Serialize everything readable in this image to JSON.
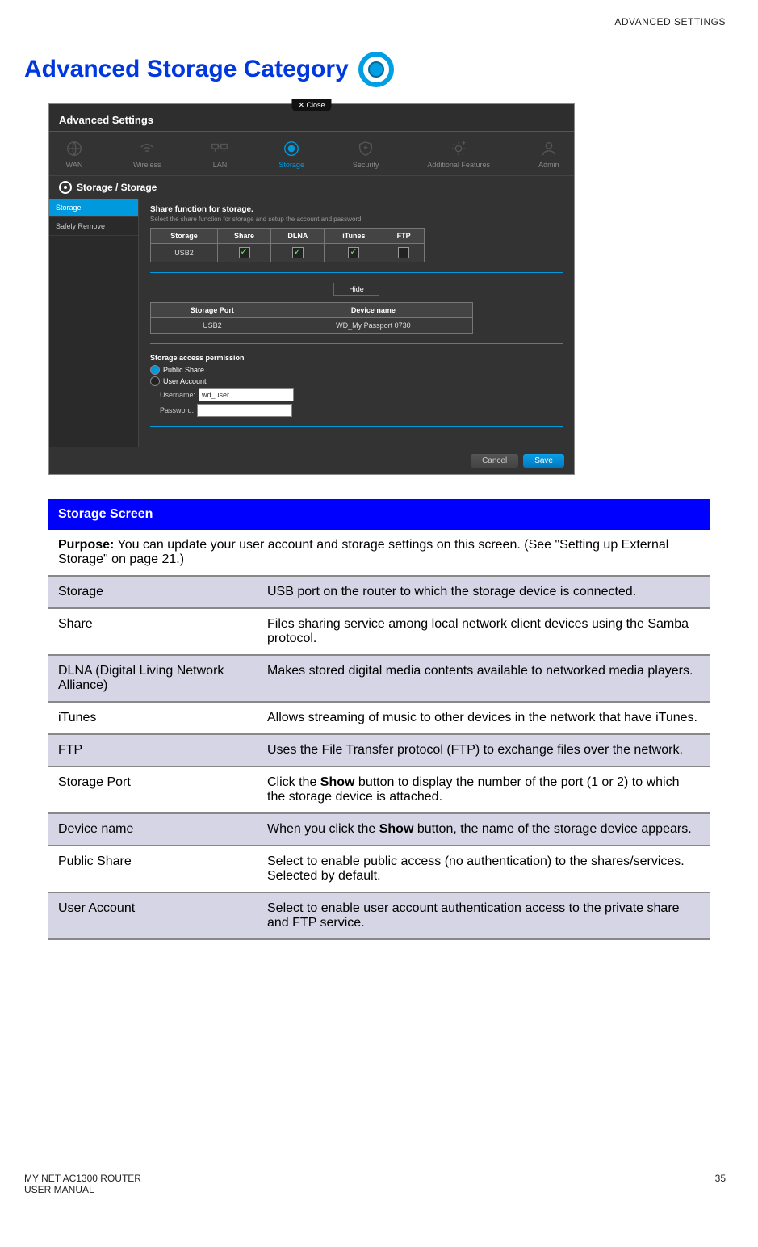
{
  "header": {
    "section": "ADVANCED SETTINGS"
  },
  "title": "Advanced Storage Category",
  "screenshot": {
    "close": "✕ Close",
    "window_title": "Advanced Settings",
    "nav": [
      {
        "label": "WAN",
        "active": false
      },
      {
        "label": "Wireless",
        "active": false
      },
      {
        "label": "LAN",
        "active": false
      },
      {
        "label": "Storage",
        "active": true
      },
      {
        "label": "Security",
        "active": false
      },
      {
        "label": "Additional Features",
        "active": false
      },
      {
        "label": "Admin",
        "active": false
      }
    ],
    "breadcrumb": "Storage / Storage",
    "sidebar": [
      {
        "label": "Storage",
        "active": true
      },
      {
        "label": "Safely Remove",
        "active": false
      }
    ],
    "section_title": "Share function for storage.",
    "section_sub": "Select the share function for storage and setup the account and password.",
    "table1": {
      "headers": [
        "Storage",
        "Share",
        "DLNA",
        "iTunes",
        "FTP"
      ],
      "row": {
        "storage": "USB2",
        "share": true,
        "dlna": true,
        "itunes": true,
        "ftp": false
      }
    },
    "hide_btn": "Hide",
    "table2": {
      "headers": [
        "Storage Port",
        "Device name"
      ],
      "row": [
        "USB2",
        "WD_My Passport 0730"
      ]
    },
    "permission_title": "Storage access permission",
    "radio_public": "Public Share",
    "radio_user": "User Account",
    "username_label": "Username:",
    "username_value": "wd_user",
    "password_label": "Password:",
    "password_value": "",
    "cancel": "Cancel",
    "save": "Save"
  },
  "desc": {
    "header": "Storage Screen",
    "purpose_label": "Purpose:",
    "purpose_text": " You can update your user account and storage settings on this screen. (See \"Setting up External Storage\" on page 21.)",
    "rows": [
      {
        "k": "Storage",
        "v": "USB port on the router to which the storage device is connected.",
        "shaded": true
      },
      {
        "k": "Share",
        "v": "Files sharing service among local network client devices using the Samba protocol.",
        "shaded": false
      },
      {
        "k": "DLNA (Digital Living Network Alliance)",
        "v": "Makes stored digital media contents available to networked media players.",
        "shaded": true
      },
      {
        "k": "iTunes",
        "v": "Allows streaming of music to other devices in the network that have iTunes.",
        "shaded": false
      },
      {
        "k": "FTP",
        "v": "Uses the File Transfer protocol (FTP) to exchange files over the network.",
        "shaded": true
      },
      {
        "k": "Storage Port",
        "v_pre": "Click the ",
        "v_b": "Show",
        "v_post": " button to display the number of the port (1 or 2) to which the storage device is attached.",
        "shaded": false
      },
      {
        "k": "Device name",
        "v_pre": "When you click the ",
        "v_b": "Show",
        "v_post": " button, the name of the storage device appears.",
        "shaded": true
      },
      {
        "k": "Public Share",
        "v": "Select to enable public access (no authentication) to the shares/services. Selected by default.",
        "shaded": false
      },
      {
        "k": "User Account",
        "v": "Select to enable user account authentication access to the private share and FTP service.",
        "shaded": true
      }
    ]
  },
  "footer": {
    "left1": "MY NET AC1300 ROUTER",
    "left2": "USER MANUAL",
    "right": "35"
  }
}
